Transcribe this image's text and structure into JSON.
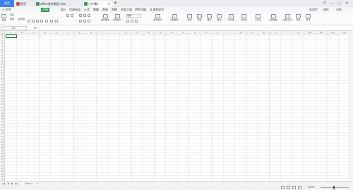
{
  "titlebar": {
    "home_tab": "首页",
    "tabs": [
      {
        "label": "稻壳",
        "color": "#e04848",
        "active": false
      },
      {
        "label": "office软件教程.xlsx",
        "color": "#2f9e48",
        "active": false
      },
      {
        "label": "工作簿1",
        "color": "#2f9e48",
        "active": true
      }
    ],
    "plus": "+",
    "controls": [
      "⊡",
      "—",
      "□",
      "✕"
    ]
  },
  "menubar": {
    "file": "≡ 文件",
    "start": "开始",
    "items": [
      "插入",
      "页面布局",
      "公式",
      "数据",
      "审阅",
      "视图",
      "开发工具",
      "特色功能"
    ],
    "search": "Q 查找命令",
    "right": [
      "未同步",
      "协作",
      "分享"
    ]
  },
  "ribbon": {
    "paste": "粘贴",
    "cut": "剪切",
    "copy": "复制",
    "format_painter": "格式刷",
    "font_name": "宋体",
    "font_size": "11",
    "merge": "合并居中",
    "wrap": "自动换行",
    "number_format": "常规",
    "conditional": "条件格式",
    "table_style": "表格样式",
    "sum": "求和",
    "filter": "筛选",
    "sort": "排序",
    "fill": "填充",
    "cell": "单元格",
    "rowcol": "行和列",
    "worksheet": "工作表",
    "freeze": "冻结窗格",
    "tools": "表格工具",
    "find": "查找",
    "symbol": "符号"
  },
  "formulabar": {
    "namebox": "A1",
    "fx": "fx",
    "value": ""
  },
  "grid": {
    "columns": [
      "A",
      "B",
      "C",
      "D",
      "E",
      "F",
      "G",
      "H",
      "I",
      "J",
      "K",
      "L",
      "M",
      "N",
      "O",
      "P",
      "Q",
      "R",
      "S",
      "T",
      "U",
      "V",
      "W",
      "X",
      "Y",
      "Z",
      "AA",
      "AB",
      "AC",
      "AD"
    ],
    "rows": [
      "1",
      "2",
      "3",
      "4",
      "5",
      "6",
      "7",
      "8",
      "9",
      "10",
      "11",
      "12",
      "13",
      "14",
      "15",
      "16",
      "17",
      "18",
      "19",
      "20",
      "21",
      "22",
      "23",
      "24",
      "25",
      "26",
      "27",
      "28",
      "29",
      "30",
      "31",
      "32",
      "33",
      "34",
      "35",
      "36",
      "37",
      "38",
      "39",
      "40",
      "41",
      "42",
      "43",
      "44",
      "45",
      "46",
      "47",
      "48",
      "49",
      "50",
      "51"
    ]
  },
  "sheets": {
    "tabs": [
      "Sheet1"
    ],
    "nav": [
      "|◀",
      "◀",
      "▶",
      "▶|"
    ],
    "add": "+"
  },
  "statusbar": {
    "zoom": "100%",
    "minus": "-",
    "plus": "+"
  }
}
